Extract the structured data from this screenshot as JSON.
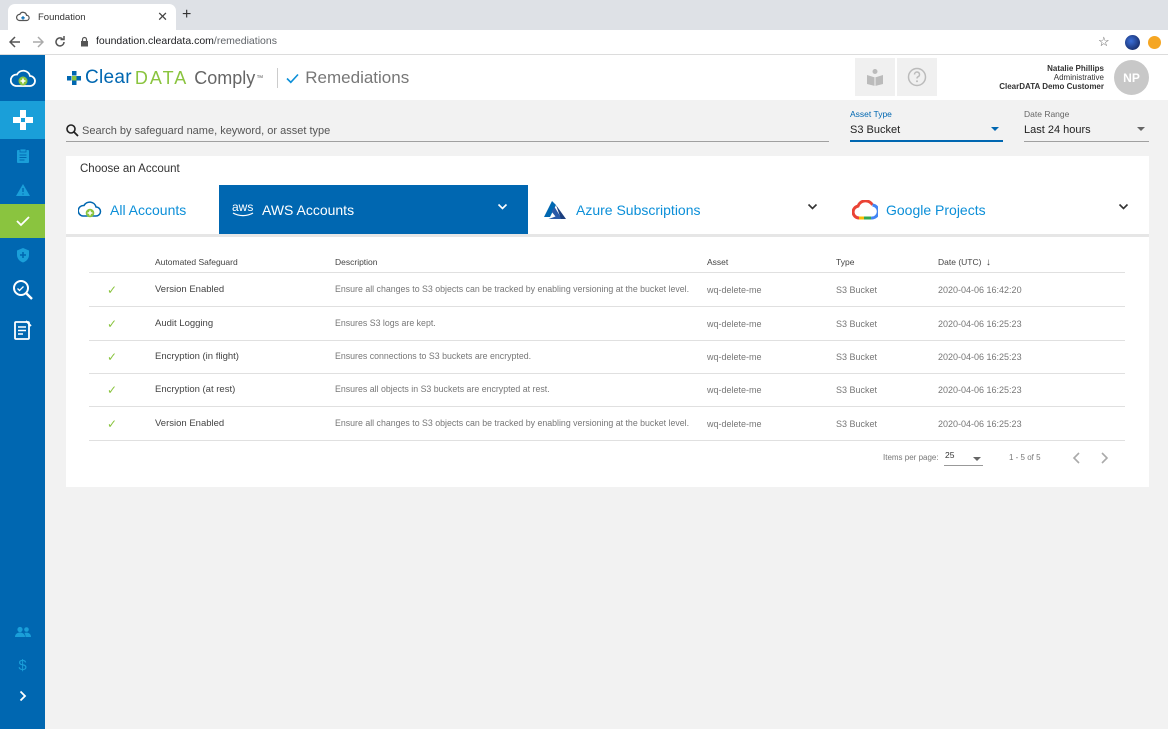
{
  "browser": {
    "tab_title": "Foundation",
    "close_glyph": "✕",
    "new_tab_glyph": "+",
    "url_host": "foundation.cleardata.com",
    "url_path": "/remediations"
  },
  "sidebar": {
    "items": [
      {
        "icon": "cloud-plus-icon"
      },
      {
        "icon": "medical-cross-icon"
      },
      {
        "icon": "clipboard-icon"
      },
      {
        "icon": "warning-icon"
      },
      {
        "icon": "check-icon",
        "active": true
      },
      {
        "icon": "shield-plus-icon"
      },
      {
        "icon": "search-magnify-icon"
      },
      {
        "icon": "report-icon"
      },
      {
        "icon": "users-icon"
      },
      {
        "icon": "dollar-icon"
      },
      {
        "icon": "chevron-right-icon"
      }
    ]
  },
  "header": {
    "brand_clear": "Clear",
    "brand_data": "DATA",
    "brand_comply": "Comply",
    "brand_tm": "™",
    "page_title": "Remediations"
  },
  "user": {
    "name": "Natalie Phillips",
    "role": "Administrative",
    "customer": "ClearDATA Demo Customer",
    "initials": "NP"
  },
  "filters": {
    "search_placeholder": "Search by safeguard name, keyword, or asset type",
    "asset_type_label": "Asset Type",
    "asset_type_value": "S3 Bucket",
    "date_range_label": "Date Range",
    "date_range_value": "Last 24 hours"
  },
  "accounts": {
    "title": "Choose an Account",
    "tabs": [
      {
        "label": "All Accounts"
      },
      {
        "label": "AWS Accounts",
        "icon_text": "aws",
        "selected": true
      },
      {
        "label": "Azure Subscriptions"
      },
      {
        "label": "Google Projects"
      }
    ]
  },
  "table": {
    "headers": [
      "Automated Safeguard",
      "Description",
      "Asset",
      "Type",
      "Date (UTC)"
    ],
    "sort_glyph": "↓",
    "check_glyph": "✓",
    "rows": [
      {
        "name": "Version Enabled",
        "description": "Ensure all changes to S3 objects can be tracked by enabling versioning at the bucket level.",
        "asset": "wq-delete-me",
        "type": "S3 Bucket",
        "date": "2020-04-06 16:42:20"
      },
      {
        "name": "Audit Logging",
        "description": "Ensures S3 logs are kept.",
        "asset": "wq-delete-me",
        "type": "S3 Bucket",
        "date": "2020-04-06 16:25:23"
      },
      {
        "name": "Encryption (in flight)",
        "description": "Ensures connections to S3 buckets are encrypted.",
        "asset": "wq-delete-me",
        "type": "S3 Bucket",
        "date": "2020-04-06 16:25:23"
      },
      {
        "name": "Encryption (at rest)",
        "description": "Ensures all objects in S3 buckets are encrypted at rest.",
        "asset": "wq-delete-me",
        "type": "S3 Bucket",
        "date": "2020-04-06 16:25:23"
      },
      {
        "name": "Version Enabled",
        "description": "Ensure all changes to S3 objects can be tracked by enabling versioning at the bucket level.",
        "asset": "wq-delete-me",
        "type": "S3 Bucket",
        "date": "2020-04-06 16:25:23"
      }
    ]
  },
  "pagination": {
    "items_per_page_label": "Items per page:",
    "items_per_page_value": "25",
    "range_text": "1 - 5 of 5"
  },
  "colors": {
    "primary_blue": "#0067b1",
    "light_blue": "#1a9fd9",
    "accent_green": "#8ac43f"
  }
}
